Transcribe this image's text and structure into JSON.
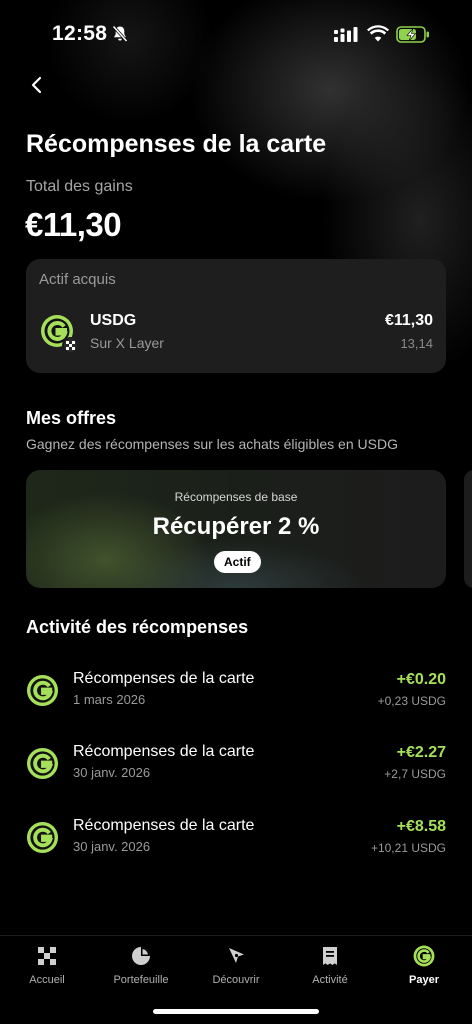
{
  "status_bar": {
    "time": "12:58"
  },
  "header": {
    "title": "Récompenses de la carte"
  },
  "totals": {
    "label": "Total des gains",
    "amount": "€11,30"
  },
  "asset_card": {
    "title": "Actif acquis",
    "asset_name": "USDG",
    "network": "Sur X Layer",
    "value": "€11,30",
    "quantity": "13,14"
  },
  "offers": {
    "title": "Mes offres",
    "subtitle": "Gagnez des récompenses sur les achats éligibles en USDG",
    "card": {
      "label": "Récompenses de base",
      "headline": "Récupérer 2 %",
      "status": "Actif"
    }
  },
  "activity": {
    "title": "Activité des récompenses",
    "items": [
      {
        "title": "Récompenses de la carte",
        "date": "1 mars 2026",
        "amount": "+€0.20",
        "qty": "+0,23 USDG"
      },
      {
        "title": "Récompenses de la carte",
        "date": "30 janv. 2026",
        "amount": "+€2.27",
        "qty": "+2,7 USDG"
      },
      {
        "title": "Récompenses de la carte",
        "date": "30 janv. 2026",
        "amount": "+€8.58",
        "qty": "+10,21 USDG"
      }
    ]
  },
  "tab_bar": {
    "tabs": [
      {
        "label": "Accueil",
        "icon": "grid-icon"
      },
      {
        "label": "Portefeuille",
        "icon": "pie-chart-icon"
      },
      {
        "label": "Découvrir",
        "icon": "compass-icon"
      },
      {
        "label": "Activité",
        "icon": "receipt-icon"
      },
      {
        "label": "Payer",
        "icon": "pay-icon",
        "active": true
      }
    ]
  },
  "colors": {
    "accent_green": "#a6e05a",
    "card_bg": "#1e1e1e"
  }
}
